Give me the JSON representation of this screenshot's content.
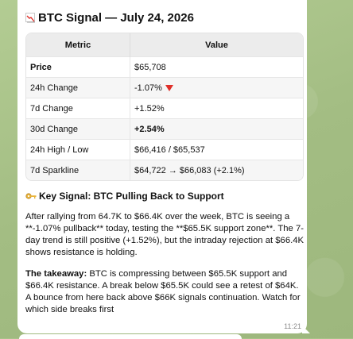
{
  "message": {
    "title": "BTC Signal — July 24, 2026",
    "table": {
      "headers": [
        "Metric",
        "Value"
      ],
      "rows": [
        {
          "metric": "Price",
          "value": "$65,708",
          "bold": true
        },
        {
          "metric": "24h Change",
          "value": "-1.07%"
        },
        {
          "metric": "7d Change",
          "value": "+1.52%"
        },
        {
          "metric": "30d Change",
          "value": "+2.54%",
          "bold_value": true
        },
        {
          "metric": "24h High / Low",
          "value": "$66,416 / $65,537"
        },
        {
          "metric": "7d Sparkline",
          "value": "$64,722 → $66,083 (+2.1%)"
        }
      ]
    },
    "section_heading": "Key Signal: BTC Pulling Back to Support",
    "paragraph1": "After rallying from 64.7K to $66.4K over the week, BTC is seeing a **-1.07% pullback** today, testing the **$65.5K support zone**. The 7-day trend is still positive (+1.52%), but the intraday rejection at $66.4K shows resistance is holding.",
    "takeaway_label": "The takeaway:",
    "takeaway_text": " BTC is compressing between $65.5K support and $66.4K resistance. A break below $65.5K could see a retest of $64K. A bounce from here back above $66K signals continuation. Watch for which side breaks first",
    "timestamp": "11:21"
  },
  "icons": {
    "title_icon": "chart-decreasing-icon",
    "section_icon": "key-icon",
    "change_indicator": "red-down-triangle-icon"
  },
  "colors": {
    "wallpaper": "#a9c28a",
    "bubble": "#ffffff",
    "down_red": "#e0302a"
  }
}
